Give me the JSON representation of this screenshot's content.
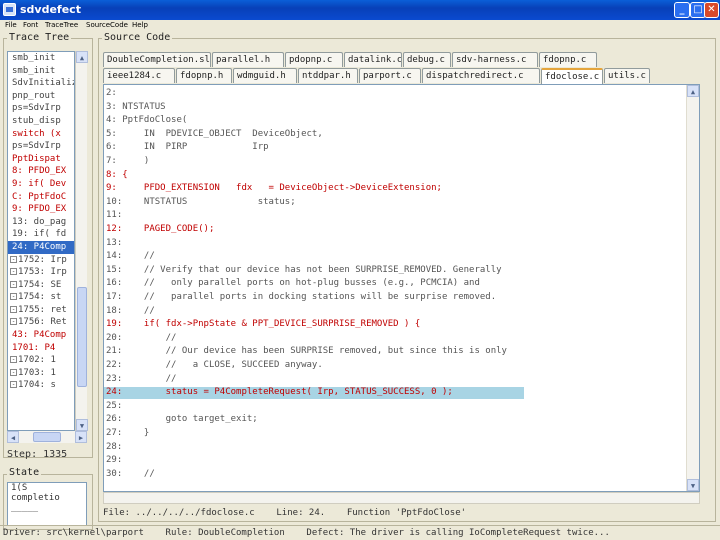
{
  "window": {
    "title": "sdvdefect",
    "minimize": "_",
    "maximize": "□",
    "close": "✕"
  },
  "menu": [
    "File",
    "Font",
    "TraceTree",
    "SourceCode",
    "Help"
  ],
  "trace_tree": {
    "label": "Trace Tree",
    "rows": [
      {
        "text": "smb_init",
        "style": "normal"
      },
      {
        "text": "smb_init",
        "style": "normal"
      },
      {
        "text": "SdvInitialize",
        "style": "normal"
      },
      {
        "text": "pnp_rout",
        "style": "normal"
      },
      {
        "text": "ps=SdvIrp",
        "style": "normal"
      },
      {
        "text": "stub_disp",
        "style": "normal"
      },
      {
        "text": "switch (x",
        "style": "red"
      },
      {
        "text": "ps=SdvIrp",
        "style": "normal"
      },
      {
        "text": "PptDispat",
        "style": "red"
      },
      {
        "text": "8: PFDO_EX",
        "style": "red"
      },
      {
        "text": "9: if( Dev",
        "style": "red"
      },
      {
        "text": "C: PptFdoC",
        "style": "red"
      },
      {
        "text": "9: PFDO_EX",
        "style": "red"
      },
      {
        "text": "13: do_pag",
        "style": "normal"
      },
      {
        "text": "19: if( fd",
        "style": "normal"
      },
      {
        "text": "24: P4Comp",
        "style": "sel"
      },
      {
        "text": "1752: Irp",
        "style": "tree"
      },
      {
        "text": "1753: Irp",
        "style": "tree"
      },
      {
        "text": "1754: SE",
        "style": "tree"
      },
      {
        "text": "1754: st",
        "style": "tree"
      },
      {
        "text": "1755: ret",
        "style": "tree"
      },
      {
        "text": "1756: Ret",
        "style": "tree"
      },
      {
        "text": "43: P4Comp",
        "style": "red"
      },
      {
        "text": "1701: P4",
        "style": "red"
      },
      {
        "text": "1702: 1",
        "style": "tree"
      },
      {
        "text": "1703: 1",
        "style": "tree"
      },
      {
        "text": "1704: s",
        "style": "tree"
      }
    ]
  },
  "step": "Step: 1335",
  "state": {
    "label": "State",
    "lines": [
      "1(S",
      "completio",
      "_____"
    ]
  },
  "source": {
    "label": "Source Code",
    "tabs_row1": [
      "DoubleCompletion.slic",
      "parallel.h",
      "pdopnp.c",
      "datalink.c",
      "debug.c",
      "sdv-harness.c",
      "fdopnp.c"
    ],
    "tabs_row2": [
      "ieee1284.c",
      "fdopnp.h",
      "wdmguid.h",
      "ntddpar.h",
      "parport.c",
      "dispatchredirect.c",
      "fdoclose.c",
      "utils.c"
    ],
    "active_tab": "fdoclose.c",
    "lines": [
      {
        "text": "2:",
        "style": "normal"
      },
      {
        "text": "3: NTSTATUS",
        "style": "normal"
      },
      {
        "text": "4: PptFdoClose(",
        "style": "normal"
      },
      {
        "text": "5:     IN  PDEVICE_OBJECT  DeviceObject,",
        "style": "normal"
      },
      {
        "text": "6:     IN  PIRP            Irp",
        "style": "normal"
      },
      {
        "text": "7:     )",
        "style": "normal"
      },
      {
        "text": "8: {",
        "style": "red"
      },
      {
        "text": "9:     PFDO_EXTENSION   fdx   = DeviceObject->DeviceExtension;",
        "style": "red"
      },
      {
        "text": "10:    NTSTATUS             status;",
        "style": "normal"
      },
      {
        "text": "11:",
        "style": "normal"
      },
      {
        "text": "12:    PAGED_CODE();",
        "style": "red"
      },
      {
        "text": "13:",
        "style": "normal"
      },
      {
        "text": "14:    //",
        "style": "normal"
      },
      {
        "text": "15:    // Verify that our device has not been SURPRISE_REMOVED. Generally",
        "style": "normal"
      },
      {
        "text": "16:    //   only parallel ports on hot-plug busses (e.g., PCMCIA) and",
        "style": "normal"
      },
      {
        "text": "17:    //   parallel ports in docking stations will be surprise removed.",
        "style": "normal"
      },
      {
        "text": "18:    //",
        "style": "normal"
      },
      {
        "text": "19:    if( fdx->PnpState & PPT_DEVICE_SURPRISE_REMOVED ) {",
        "style": "red"
      },
      {
        "text": "20:        //",
        "style": "normal"
      },
      {
        "text": "21:        // Our device has been SURPRISE removed, but since this is only",
        "style": "normal"
      },
      {
        "text": "22:        //   a CLOSE, SUCCEED anyway.",
        "style": "normal"
      },
      {
        "text": "23:        //",
        "style": "normal"
      },
      {
        "text": "24:        status = P4CompleteRequest( Irp, STATUS_SUCCESS, 0 );",
        "style": "hl"
      },
      {
        "text": "25:",
        "style": "normal"
      },
      {
        "text": "26:        goto target_exit;",
        "style": "normal"
      },
      {
        "text": "27:    }",
        "style": "normal"
      },
      {
        "text": "28:",
        "style": "normal"
      },
      {
        "text": "29:",
        "style": "normal"
      },
      {
        "text": "30:    //",
        "style": "normal"
      }
    ],
    "status": "File: ../../../../fdoclose.c    Line: 24.    Function 'PptFdoClose'"
  },
  "bottom_status": "Driver: src\\kernel\\parport    Rule: DoubleCompletion    Defect: The driver is calling IoCompleteRequest twice..."
}
